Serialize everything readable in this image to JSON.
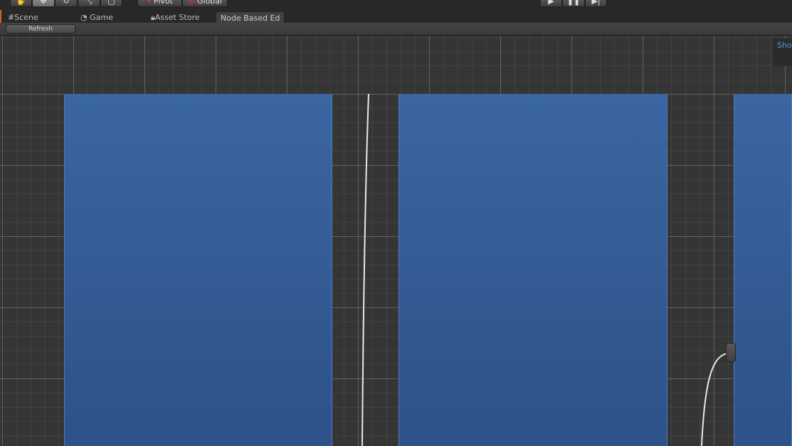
{
  "toolbar": {
    "tools": [
      "hand-icon",
      "move-icon",
      "rotate-icon",
      "scale-icon",
      "rect-icon"
    ],
    "pivot_label": "Pivot",
    "global_label": "Global",
    "play_controls": [
      "play-icon",
      "pause-icon",
      "step-icon"
    ]
  },
  "tabs": [
    {
      "label": "Scene",
      "icon": "grid-icon"
    },
    {
      "label": "Game",
      "icon": "pacman-icon"
    },
    {
      "label": "Asset Store",
      "icon": "lock-bag-icon"
    },
    {
      "label": "Node Based Ed",
      "active": true
    }
  ],
  "subbar": {
    "refresh_label": "Refresh"
  },
  "canvas": {
    "show_label": "Sho",
    "node_color": "#3a66a1",
    "accent": "#5b8ef0"
  }
}
